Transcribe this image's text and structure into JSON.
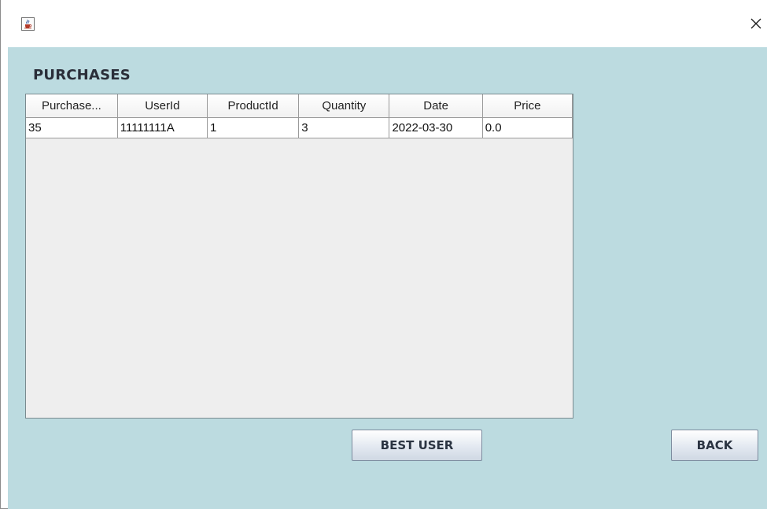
{
  "window": {
    "app_icon": "java-cup-icon",
    "close_icon": "close-icon",
    "close_glyph": "✕"
  },
  "page": {
    "heading": "PURCHASES"
  },
  "table": {
    "columns": [
      "Purchase...",
      "UserId",
      "ProductId",
      "Quantity",
      "Date",
      "Price"
    ],
    "rows": [
      [
        "35",
        "11111111A",
        "1",
        "3",
        "2022-03-30",
        "0.0"
      ]
    ]
  },
  "buttons": {
    "best_user": "BEST USER",
    "back": "BACK"
  },
  "colors": {
    "background": "#bcdbe0",
    "table_area": "#eeeeee",
    "heading_text": "#2a2e39"
  }
}
